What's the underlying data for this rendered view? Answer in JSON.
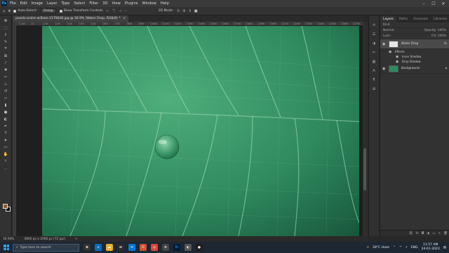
{
  "menu": {
    "items": [
      "File",
      "Edit",
      "Image",
      "Layer",
      "Type",
      "Select",
      "Filter",
      "3D",
      "View",
      "Plugins",
      "Window",
      "Help"
    ]
  },
  "window": {
    "minimize": "–",
    "maximize": "☐",
    "close": "✕"
  },
  "options": {
    "auto_select_label": "Auto-Select:",
    "auto_select_value": "Group",
    "transform_label": "Show Transform Controls",
    "mode_3d": "3D Mode:"
  },
  "document": {
    "tab_title": "pexels-andre-william-2179628.jpg @ 30.9% (Water Drop, RGB/8) *",
    "close": "×"
  },
  "ruler": {
    "ticks": [
      "-100",
      "0",
      "100",
      "200",
      "300",
      "400",
      "500",
      "600",
      "700",
      "800",
      "900",
      "1000",
      "1100",
      "1200",
      "1300",
      "1400",
      "1500",
      "1600",
      "1700",
      "1800",
      "1900",
      "2000",
      "2100",
      "2200",
      "2300",
      "2400",
      "2500",
      "2600",
      "2700"
    ]
  },
  "status": {
    "zoom": "30.94%",
    "doc_info": "3840 px x 2006 px (72 ppi)",
    "arrow": ">"
  },
  "panel": {
    "tabs": [
      "Layers",
      "Paths",
      "Channels",
      "Libraries"
    ],
    "kind_label": "Kind",
    "normal_label": "Normal",
    "opacity_label": "Opacity: 100%",
    "lock_label": "Lock:",
    "fill_label": "Fill: 100%",
    "layers": [
      {
        "name": "Water Drop",
        "fx": "fx",
        "effects_label": "Effects",
        "effects": [
          "Inner Shadow",
          "Drop Shadow"
        ]
      },
      {
        "name": "Background"
      }
    ]
  },
  "taskbar": {
    "search_placeholder": "Type here to search",
    "weather": "28°C  Haze",
    "lang": "ENG",
    "time": "11:57 AM",
    "date": "24-01-2023"
  }
}
